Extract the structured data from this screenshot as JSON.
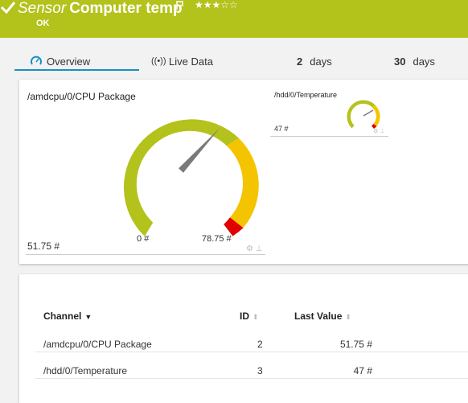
{
  "header": {
    "title_prefix": "Sensor",
    "title_name": "Computer temp",
    "status": "OK",
    "stars": "★★★☆☆",
    "colors": {
      "header_bg": "#b4c21c",
      "accent": "#1a8fc6"
    }
  },
  "tabs": [
    {
      "label": "Overview",
      "icon": "gauge-icon",
      "active": true
    },
    {
      "label": "Live Data",
      "icon": "live-signal-icon"
    },
    {
      "num": "2",
      "label": "days"
    },
    {
      "num": "30",
      "label": "days"
    }
  ],
  "gauges": [
    {
      "title": "/amdcpu/0/CPU Package",
      "value_label": "51.75 #",
      "min_label": "0 #",
      "max_label": "78.75 #",
      "value": 51.75,
      "min": 0,
      "max": 78.75
    },
    {
      "title": "/hdd/0/Temperature",
      "value_label": "47 #",
      "value": 47
    }
  ],
  "table": {
    "headers": {
      "channel": "Channel",
      "id": "ID",
      "last": "Last Value"
    },
    "rows": [
      {
        "channel": "/amdcpu/0/CPU Package",
        "id": "2",
        "last": "51.75 #"
      },
      {
        "channel": "/hdd/0/Temperature",
        "id": "3",
        "last": "47 #"
      }
    ]
  }
}
